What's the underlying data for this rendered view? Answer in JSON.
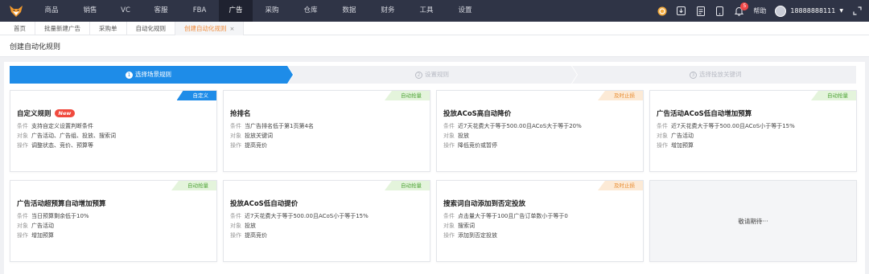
{
  "nav": {
    "items": [
      {
        "label": "商品",
        "w": 48
      },
      {
        "label": "销售",
        "w": 48
      },
      {
        "label": "VC",
        "w": 40
      },
      {
        "label": "客服",
        "w": 48
      },
      {
        "label": "FBA",
        "w": 48
      },
      {
        "label": "广告",
        "w": 42
      },
      {
        "label": "采购",
        "w": 48
      },
      {
        "label": "仓库",
        "w": 48
      },
      {
        "label": "数据",
        "w": 48
      },
      {
        "label": "财务",
        "w": 48
      },
      {
        "label": "工具",
        "w": 48
      },
      {
        "label": "设置",
        "w": 48
      }
    ],
    "active_index": 5,
    "notification_count": "5",
    "help_label": "帮助",
    "username": "18888888111"
  },
  "tabs": [
    {
      "label": "首页"
    },
    {
      "label": "批量新建广告"
    },
    {
      "label": "采购单"
    },
    {
      "label": "自动化规则"
    },
    {
      "label": "创建自动化规则",
      "active": true,
      "close": "×"
    }
  ],
  "page_title": "创建自动化规则",
  "steps": [
    {
      "num": "1",
      "label": "选择场景规则"
    },
    {
      "num": "2",
      "label": "设置规则"
    },
    {
      "num": "3",
      "label": "选择投放关键词"
    }
  ],
  "row_keys": {
    "cond": "条件",
    "target": "对象",
    "op": "操作"
  },
  "cards": [
    {
      "tag": "自定义",
      "tag_color": "blue",
      "title": "自定义规则",
      "new": "New",
      "cond": "支持自定义设置判断条件",
      "target": "广告活动、广告组、投放、搜索词",
      "op": "调整状态、竞价、预算等"
    },
    {
      "tag": "自动抢量",
      "tag_color": "green",
      "title": "抢排名",
      "cond": "当广告排名低于第1页第4名",
      "target": "投放关键词",
      "op": "提高竞价"
    },
    {
      "tag": "及时止损",
      "tag_color": "orange",
      "title": "投放ACoS高自动降价",
      "cond": "近7天花费大于等于500.00且ACoS大于等于20%",
      "target": "投放",
      "op": "降低竞价或暂停"
    },
    {
      "tag": "自动抢量",
      "tag_color": "green",
      "title": "广告活动ACoS低自动增加预算",
      "cond": "近7天花费大于等于500.00且ACoS小于等于15%",
      "target": "广告活动",
      "op": "增加预算"
    },
    {
      "tag": "自动抢量",
      "tag_color": "green",
      "title": "广告活动超预算自动增加预算",
      "cond": "当日预算剩余低于10%",
      "target": "广告活动",
      "op": "增加预算"
    },
    {
      "tag": "自动抢量",
      "tag_color": "green",
      "title": "投放ACoS低自动提价",
      "cond": "近7天花费大于等于500.00且ACoS小于等于15%",
      "target": "投放",
      "op": "提高竞价"
    },
    {
      "tag": "及时止损",
      "tag_color": "orange",
      "title": "搜索词自动添加到否定投放",
      "cond": "点击量大于等于100且广告订单数小于等于0",
      "target": "搜索词",
      "op": "添加到否定投放"
    }
  ],
  "coming_soon": "敬请期待···",
  "colors": {
    "accent": "#1e8ce8",
    "nav_bg": "#2f3446",
    "tab_active": "#f08c3c"
  }
}
